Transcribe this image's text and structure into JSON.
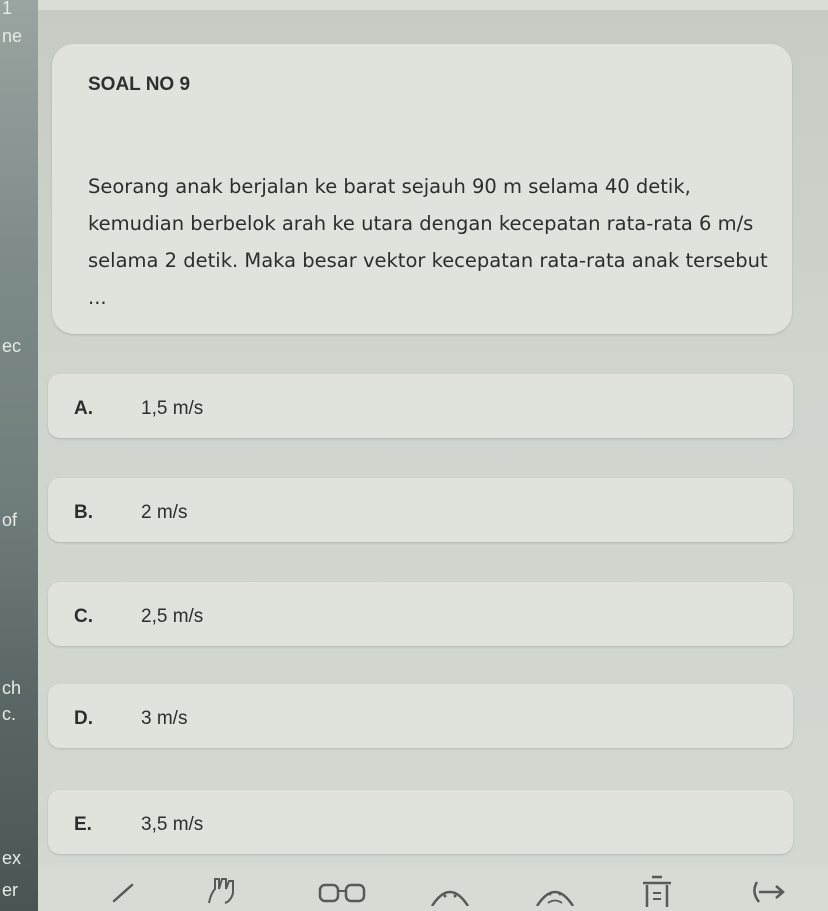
{
  "question": {
    "title": "SOAL NO 9",
    "text": "Seorang anak berjalan ke barat sejauh 90 m selama 40 detik, kemudian berbelok arah ke utara dengan kecepatan rata-rata 6 m/s selama 2 detik. Maka besar vektor kecepatan rata-rata anak tersebut ..."
  },
  "options": [
    {
      "letter": "A.",
      "value": "1,5 m/s"
    },
    {
      "letter": "B.",
      "value": "2 m/s"
    },
    {
      "letter": "C.",
      "value": "2,5 m/s"
    },
    {
      "letter": "D.",
      "value": "3 m/s"
    },
    {
      "letter": "E.",
      "value": "3,5 m/s"
    }
  ],
  "left_fragments": [
    "1",
    "ne",
    "ec",
    "of",
    "ch",
    "c.",
    "ex",
    "er"
  ],
  "toolbar": {
    "icons": [
      "pen-icon",
      "hand-icon",
      "glasses-icon",
      "face-icon",
      "sad-face-icon",
      "trash-icon",
      "next-arrow-icon"
    ]
  },
  "colors": {
    "card": "#dfe3dc",
    "background": "#cfd4cd",
    "text": "#2b2f2c"
  }
}
